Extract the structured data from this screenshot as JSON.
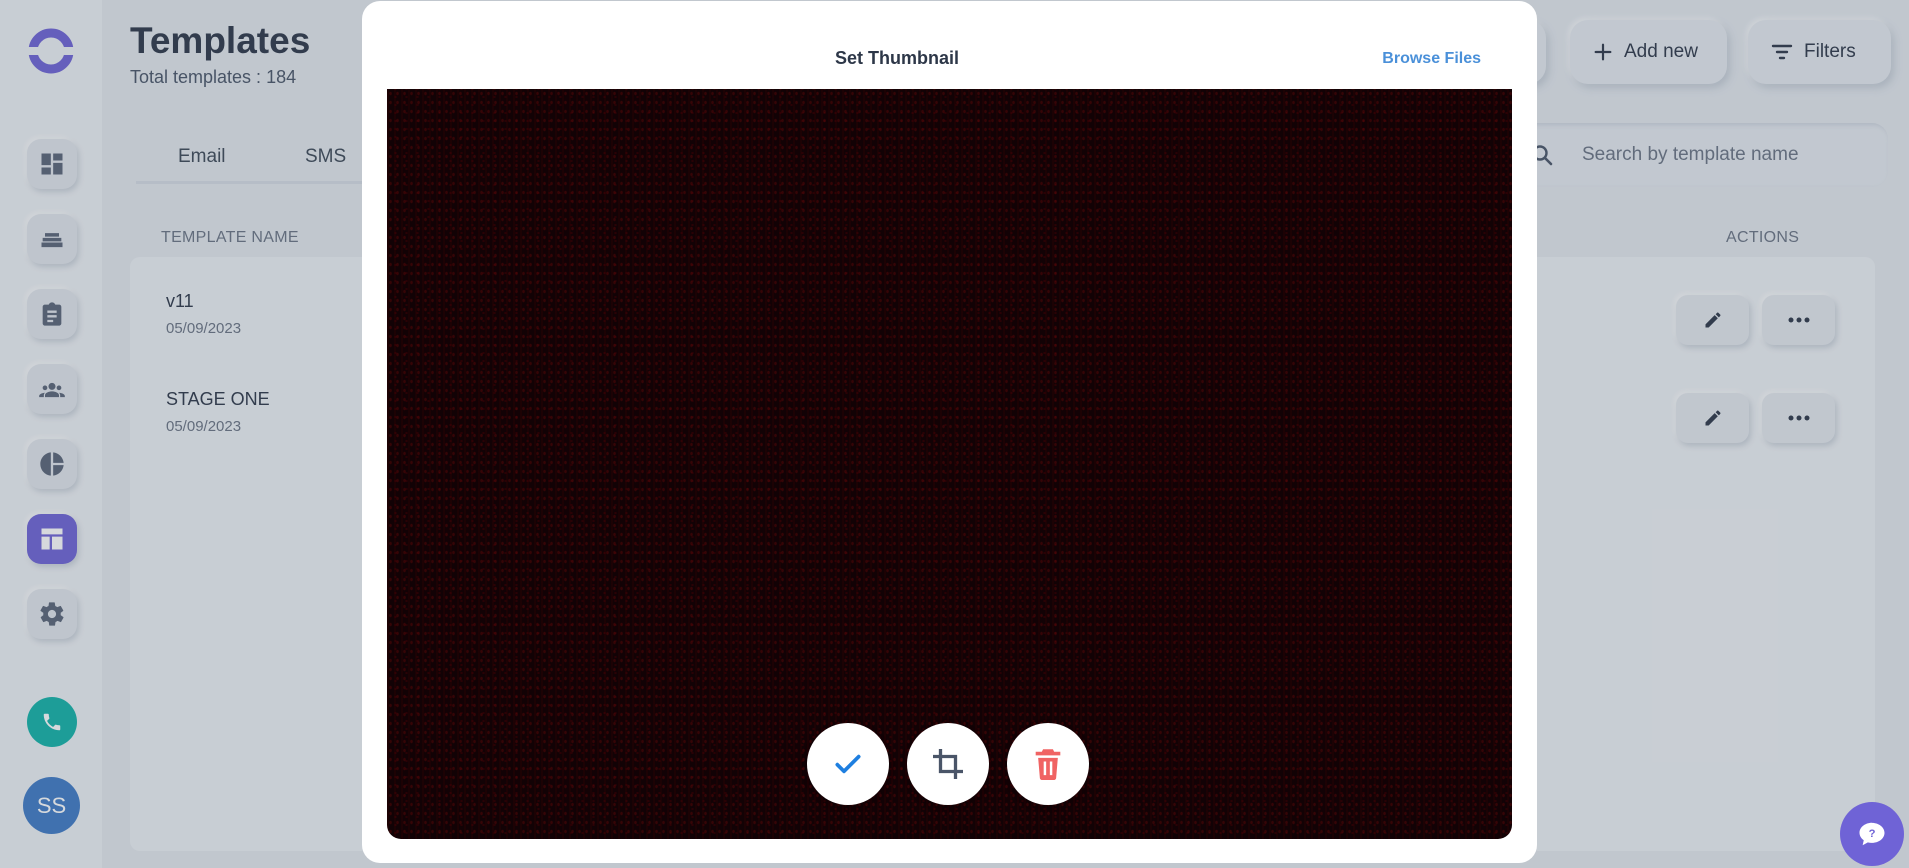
{
  "sidebar": {
    "items": [
      {
        "icon": "dashboard-icon"
      },
      {
        "icon": "layers-icon"
      },
      {
        "icon": "clipboard-icon"
      },
      {
        "icon": "users-icon"
      },
      {
        "icon": "pie-chart-icon"
      },
      {
        "icon": "templates-icon",
        "active": true
      },
      {
        "icon": "gear-icon"
      }
    ],
    "call_icon": "phone-icon",
    "avatar_initials": "SS"
  },
  "header": {
    "title": "Templates",
    "subtitle": "Total templates : 184",
    "add_new_label": "Add new",
    "filters_label": "Filters"
  },
  "tabs": [
    {
      "label": "Email"
    },
    {
      "label": "SMS"
    }
  ],
  "search": {
    "placeholder": "Search by template name",
    "value": ""
  },
  "table": {
    "columns": {
      "name": "TEMPLATE NAME",
      "actions": "ACTIONS"
    },
    "rows": [
      {
        "name": "v11",
        "date": "05/09/2023"
      },
      {
        "name": "STAGE ONE",
        "date": "05/09/2023"
      }
    ]
  },
  "modal": {
    "title": "Set Thumbnail",
    "browse_label": "Browse Files",
    "actions": [
      {
        "icon": "check-icon"
      },
      {
        "icon": "crop-icon"
      },
      {
        "icon": "trash-icon"
      }
    ]
  },
  "colors": {
    "accent": "#6f63d6",
    "link": "#4a90d9",
    "call": "#12b3a8",
    "danger": "#f06363",
    "confirm": "#1e7fe0"
  }
}
